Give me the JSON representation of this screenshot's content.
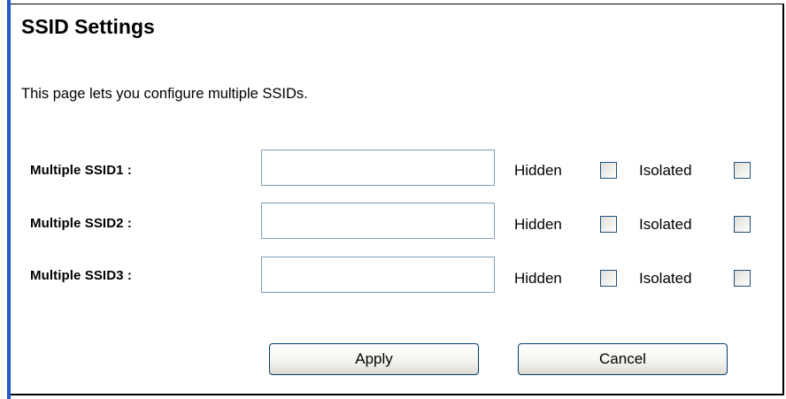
{
  "header": {
    "title": "SSID Settings"
  },
  "description": "This page lets you configure multiple SSIDs.",
  "ssids": [
    {
      "label": "Multiple SSID1 :",
      "value": "",
      "hidden_label": "Hidden",
      "hidden_checked": false,
      "isolated_label": "Isolated",
      "isolated_checked": false
    },
    {
      "label": "Multiple SSID2 :",
      "value": "",
      "hidden_label": "Hidden",
      "hidden_checked": false,
      "isolated_label": "Isolated",
      "isolated_checked": false
    },
    {
      "label": "Multiple SSID3 :",
      "value": "",
      "hidden_label": "Hidden",
      "hidden_checked": false,
      "isolated_label": "Isolated",
      "isolated_checked": false
    }
  ],
  "buttons": {
    "apply_label": "Apply",
    "cancel_label": "Cancel"
  },
  "colors": {
    "accent_bar": "#2457c7",
    "input_border": "#7f9db9",
    "button_border": "#003c74",
    "checkbox_border": "#1c5180"
  }
}
